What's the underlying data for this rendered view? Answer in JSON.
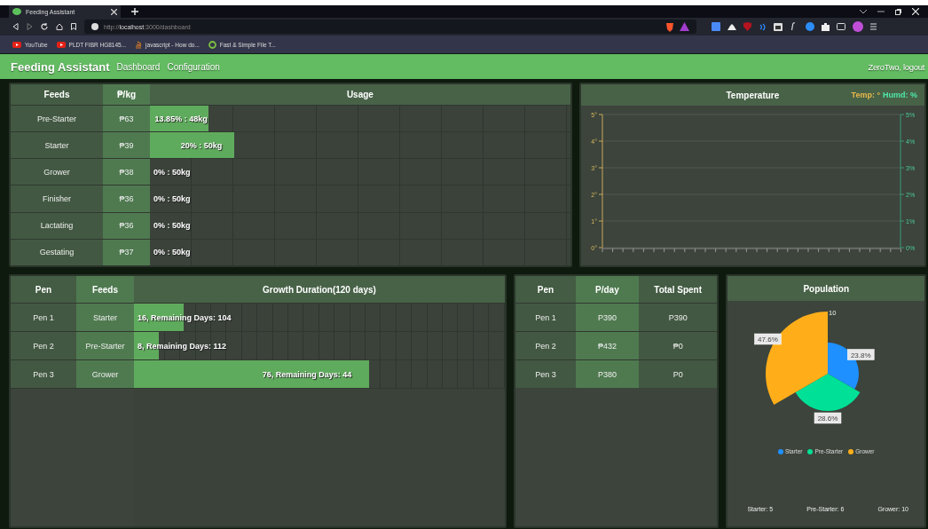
{
  "browser": {
    "tab_title": "Feeding Assistant",
    "url_scheme": "http://",
    "url_host": "localhost",
    "url_rest": ":3000/dashboard",
    "bookmarks": [
      {
        "label": "YouTube",
        "kind": "youtube"
      },
      {
        "label": "PLDT FIBR HG8145...",
        "kind": "youtube"
      },
      {
        "label": "javascript - How do...",
        "kind": "stack"
      },
      {
        "label": "Fast & Simple File T...",
        "kind": "ring"
      }
    ]
  },
  "app": {
    "title": "Feeding Assistant",
    "nav": [
      {
        "label": "Dashboard"
      },
      {
        "label": "Configuration"
      }
    ],
    "user": "ZeroTwo, logout"
  },
  "feeds_table": {
    "columns": [
      "Feeds",
      "₱/kg",
      "Usage"
    ],
    "rows": [
      {
        "feed": "Pre-Starter",
        "price": "₱63",
        "usage": "13.85% : 48kg",
        "level": 0.1385
      },
      {
        "feed": "Starter",
        "price": "₱39",
        "usage": "20% : 50kg",
        "level": 0.2
      },
      {
        "feed": "Grower",
        "price": "₱38",
        "usage": "0% : 50kg"
      },
      {
        "feed": "Finisher",
        "price": "₱36",
        "usage": "0% : 50kg"
      },
      {
        "feed": "Lactating",
        "price": "₱36",
        "usage": "0% : 50kg"
      },
      {
        "feed": "Gestating",
        "price": "₱37",
        "usage": "0% : 50kg"
      }
    ]
  },
  "temperature": {
    "title": "Temperature",
    "temp_label": "Temp: °",
    "humd_label": "Humd: %",
    "left_ticks": [
      "5°",
      "4°",
      "3°",
      "2°",
      "1°",
      "0°"
    ],
    "right_ticks": [
      "5%",
      "4%",
      "3%",
      "2%",
      "1%",
      "0%"
    ]
  },
  "growth_table": {
    "columns": [
      "Pen",
      "Feeds",
      "Growth Duration(120 days)"
    ],
    "rows": [
      {
        "pen": "Pen 1",
        "feed": "Starter",
        "progress": "16, Remaining Days: 104",
        "level": 0.1333
      },
      {
        "pen": "Pen 2",
        "feed": "Pre-Starter",
        "progress": "8, Remaining Days: 112",
        "level": 0.0667
      },
      {
        "pen": "Pen 3",
        "feed": "Grower",
        "progress": "76, Remaining Days: 44",
        "level": 0.6333
      }
    ]
  },
  "cost_table": {
    "columns": [
      "Pen",
      "P/day",
      "Total Spent"
    ],
    "rows": [
      {
        "pen": "Pen 1",
        "per_day": "P390",
        "total": "P390"
      },
      {
        "pen": "Pen 2",
        "per_day": "₱432",
        "total": "₱0"
      },
      {
        "pen": "Pen 3",
        "per_day": "P380",
        "total": "P0"
      }
    ]
  },
  "population": {
    "title": "Population",
    "slice_labels": [
      "23.8%",
      "28.6%",
      "47.6%"
    ],
    "radial_tick": "10",
    "legend": [
      {
        "label": "Starter",
        "color": "#1e90ff"
      },
      {
        "label": "Pre-Starter",
        "color": "#00e096"
      },
      {
        "label": "Grower",
        "color": "#ffae1a"
      }
    ],
    "counts": [
      "Starter: 5",
      "Pre-Starter: 6",
      "Grower: 10"
    ]
  }
}
